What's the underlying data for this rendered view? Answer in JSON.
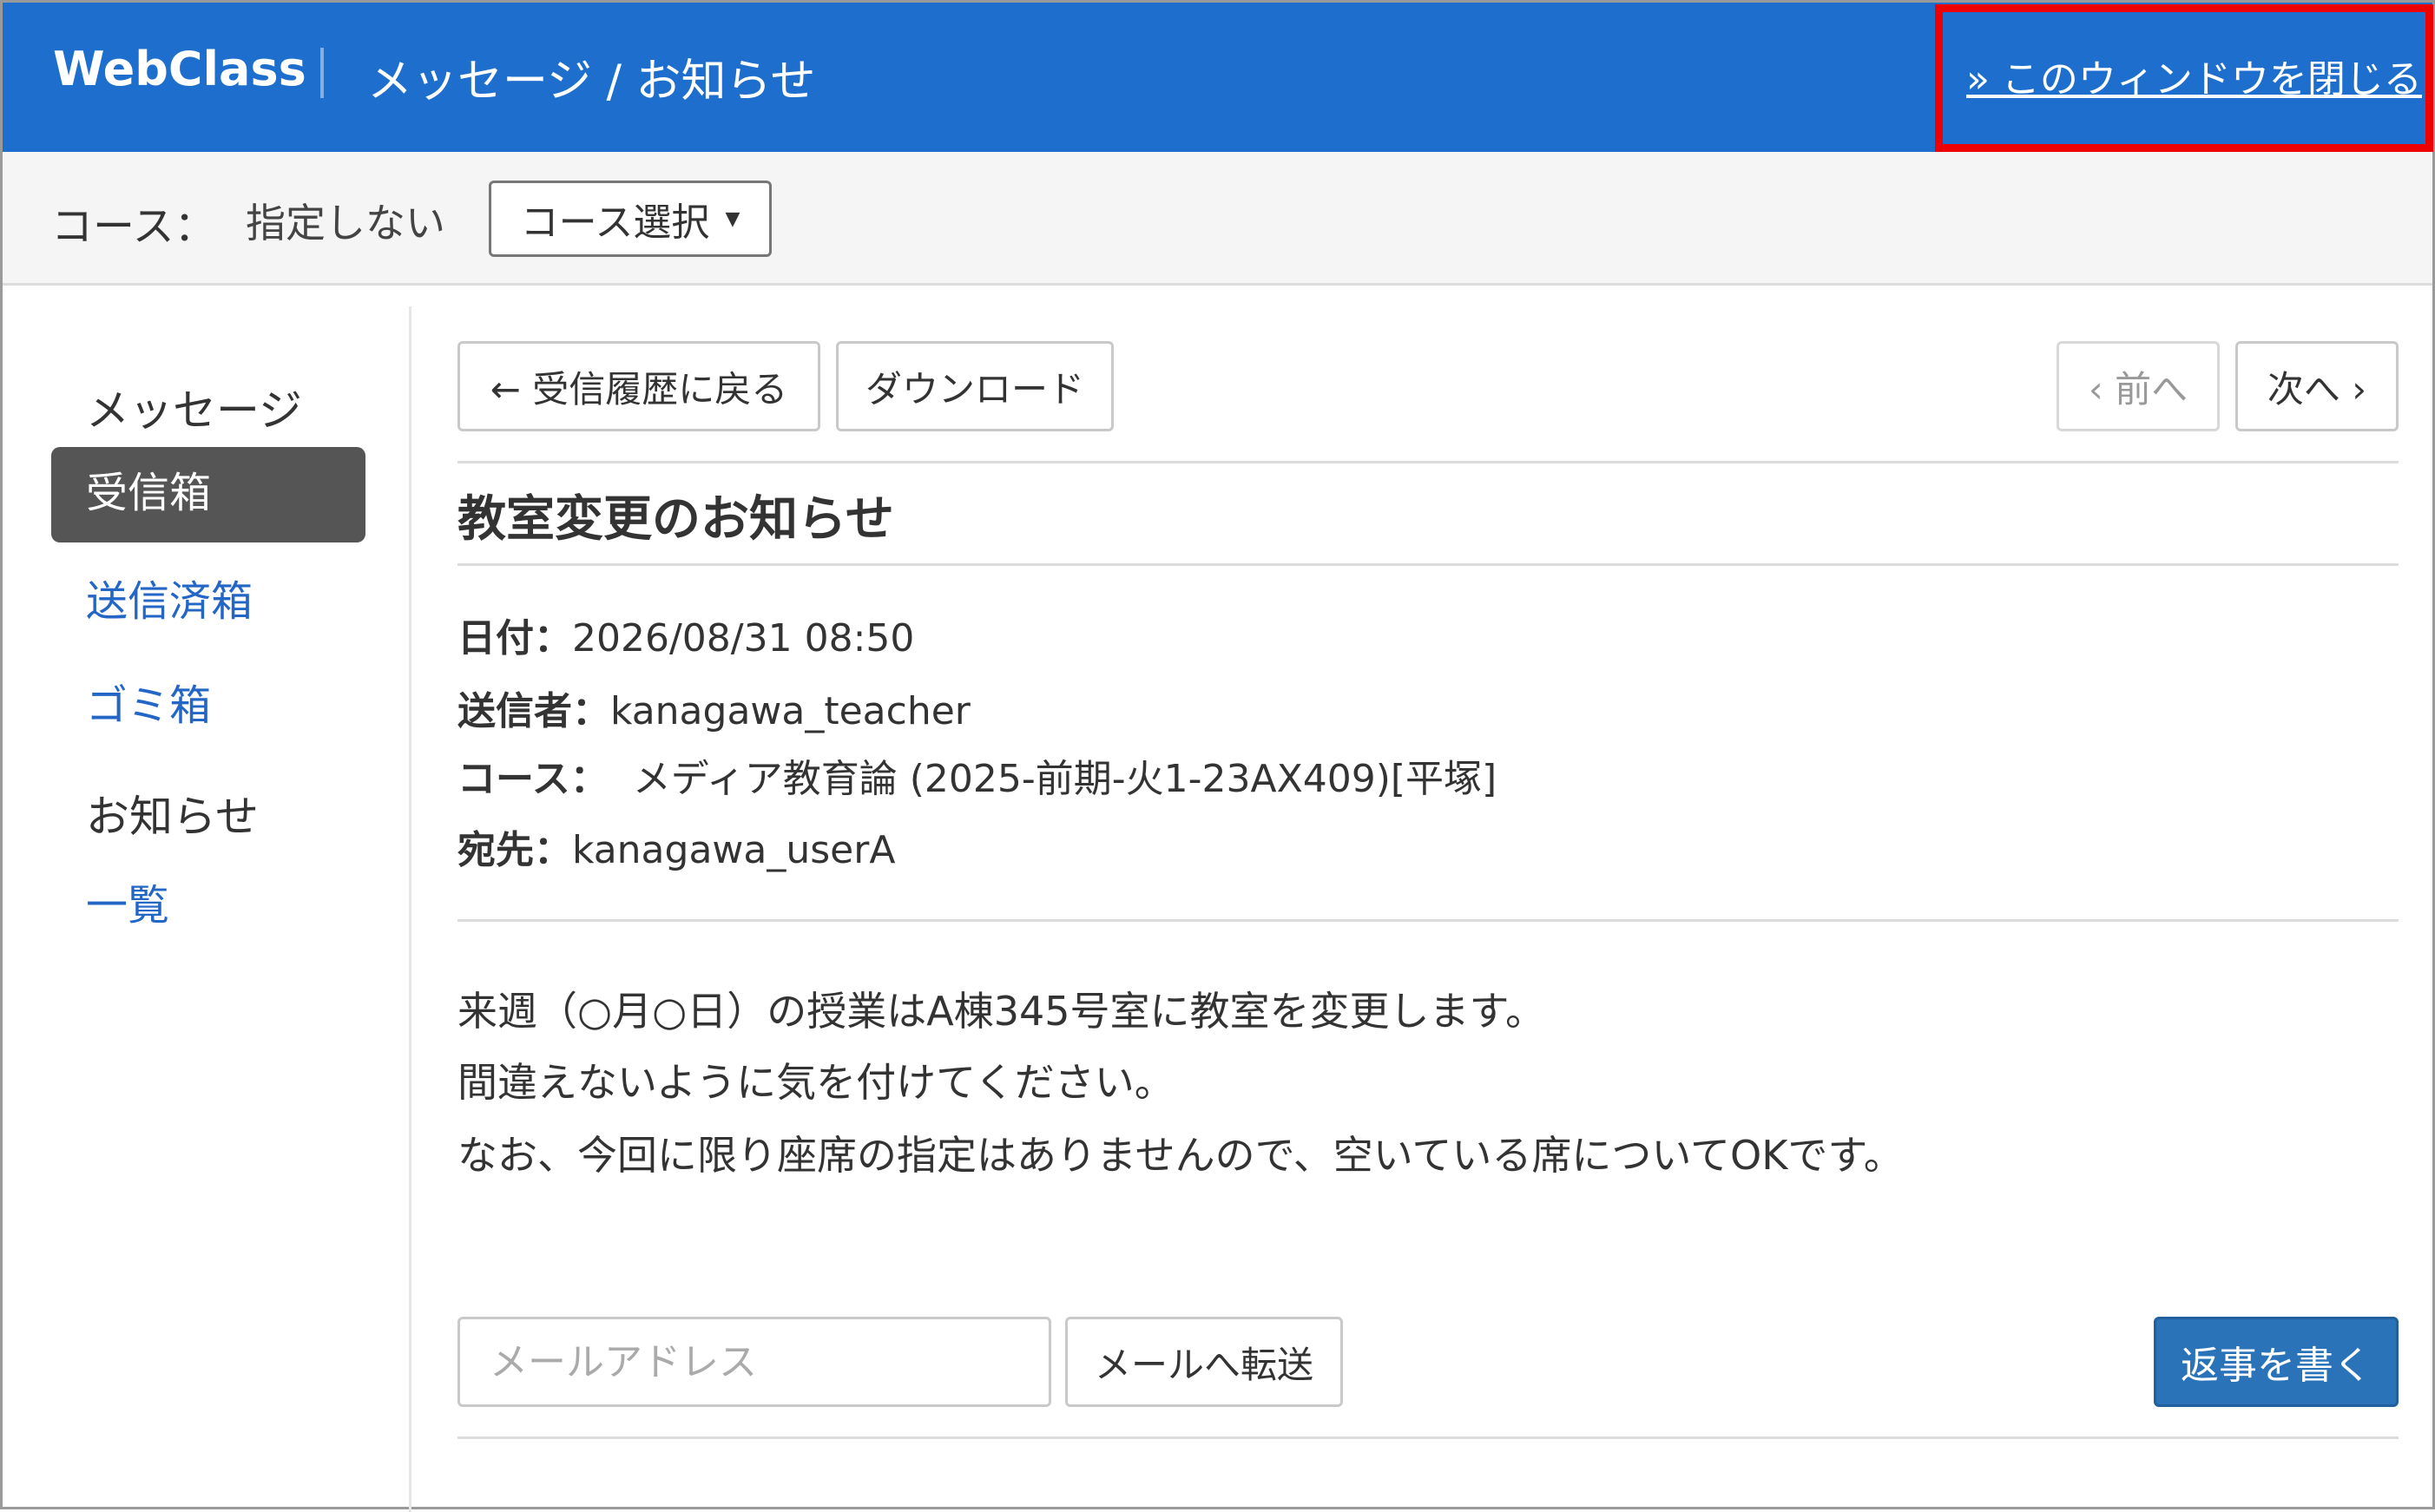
{
  "header": {
    "brand": "WebClass",
    "title": "メッセージ / お知らせ",
    "close_link": "» このウィンドウを閉じる"
  },
  "course_bar": {
    "label": "コース：",
    "value": "指定しない",
    "select_label": "コース選択"
  },
  "sidebar": {
    "messages_heading": "メッセージ",
    "inbox": "受信箱",
    "sent": "送信済箱",
    "trash": "ゴミ箱",
    "notices_heading": "お知らせ",
    "list": "一覧"
  },
  "toolbar": {
    "back": "← 受信履歴に戻る",
    "download": "ダウンロード",
    "prev": "‹ 前へ",
    "next": "次へ ›"
  },
  "message": {
    "title": "教室変更のお知らせ",
    "date_label": "日付：",
    "date": "2026/08/31 08:50",
    "sender_label": "送信者：",
    "sender": "kanagawa_teacher",
    "course_label": "コース：",
    "course": "メディア教育論 (2025-前期-火1-23AX409)[平塚]",
    "to_label": "宛先：",
    "to": "kanagawa_userA",
    "body": [
      "来週（○月○日）の授業はA棟345号室に教室を変更します。",
      "間違えないように気を付けてください。",
      "なお、今回に限り座席の指定はありませんので、空いている席についてOKです。"
    ]
  },
  "footer": {
    "email_placeholder": "メールアドレス",
    "forward": "メールへ転送",
    "reply": "返事を書く"
  },
  "colors": {
    "header_bg": "#1e6fcd",
    "link": "#2366c5",
    "active_nav": "#555555",
    "reply_button": "#2a73b9",
    "highlight_box": "#ee0000"
  }
}
